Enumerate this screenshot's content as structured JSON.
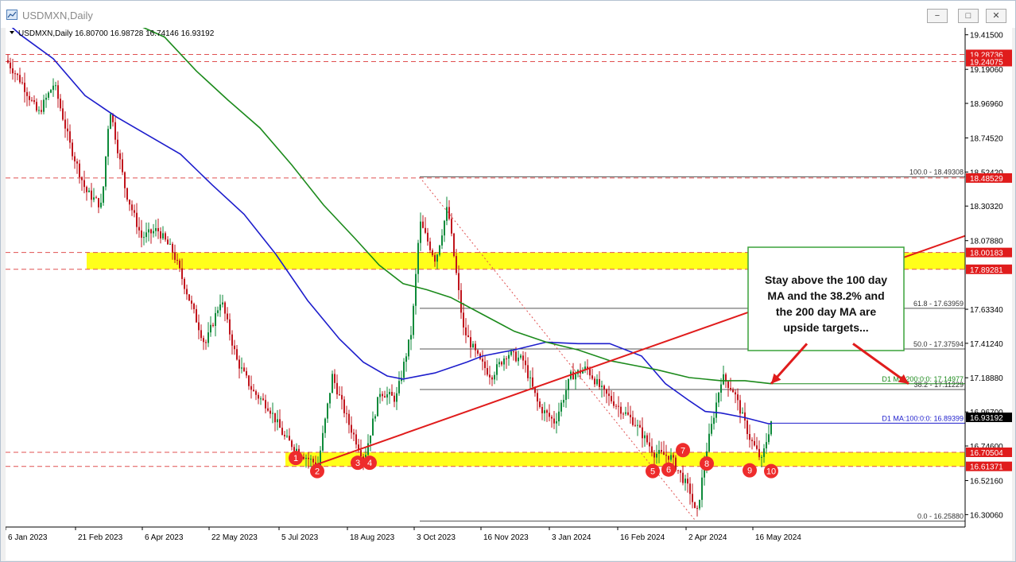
{
  "window": {
    "title": "USDMXN,Daily",
    "minimize_label": "−",
    "maximize_label": "□",
    "close_label": "✕"
  },
  "info_line": {
    "symbol": "USDMXN,Daily",
    "open": "16.80700",
    "high": "16.98728",
    "low": "16.74146",
    "close": "16.93192"
  },
  "colors": {
    "candle_up": "#0d8a3a",
    "candle_down": "#c0141c",
    "ma100": "#1d1dcc",
    "ma200": "#1b8a1b",
    "trendline": "#e01c1c",
    "support_zone": "#ffff1a",
    "marker": "#ee2c2c",
    "current_price_bg": "#000000",
    "level_bg": "#e01c1c"
  },
  "chart_data": {
    "type": "candlestick",
    "symbol": "USDMXN",
    "timeframe": "Daily",
    "x_ticks": [
      "6 Jan 2023",
      "21 Feb 2023",
      "6 Apr 2023",
      "22 May 2023",
      "5 Jul 2023",
      "18 Aug 2023",
      "3 Oct 2023",
      "16 Nov 2023",
      "3 Jan 2024",
      "16 Feb 2024",
      "2 Apr 2024",
      "16 May 2024"
    ],
    "y_ticks": [
      "19.41500",
      "19.19060",
      "18.96960",
      "18.74520",
      "18.52420",
      "18.30320",
      "18.07880",
      "17.63340",
      "17.41240",
      "17.18880",
      "16.96700",
      "16.74600",
      "16.52160",
      "16.30060"
    ],
    "ylim": [
      16.22,
      19.46
    ],
    "price_labels": [
      {
        "value": 19.28736,
        "text": "19.28736"
      },
      {
        "value": 19.24075,
        "text": "19.24075"
      },
      {
        "value": 18.48529,
        "text": "18.48529"
      },
      {
        "value": 18.00183,
        "text": "18.00183"
      },
      {
        "value": 17.89281,
        "text": "17.89281"
      },
      {
        "value": 16.70504,
        "text": "16.70504"
      },
      {
        "value": 16.61371,
        "text": "16.61371"
      }
    ],
    "current_price": {
      "value": 16.93192,
      "text": "16.93192"
    },
    "support_zones": [
      {
        "from": 17.89281,
        "to": 18.00183
      },
      {
        "from": 16.61371,
        "to": 16.70504
      }
    ],
    "fibonacci": [
      {
        "level": "100.0",
        "value": 18.49308,
        "label": "100.0 - 18.49308"
      },
      {
        "level": "61.8",
        "value": 17.63959,
        "label": "61.8 - 17.63959"
      },
      {
        "level": "50.0",
        "value": 17.37594,
        "label": "50.0 - 17.37594"
      },
      {
        "level": "38.2",
        "value": 17.11229,
        "label": "38.2 - 17.11229"
      },
      {
        "level": "0.0",
        "value": 16.2588,
        "label": "0.0 - 16.25880"
      }
    ],
    "ma_labels": [
      {
        "name": "D1 MA:200:0:0",
        "value": 17.14977,
        "label": "D1 MA:200:0:0: 17.14977"
      },
      {
        "name": "D1 MA:100:0:0",
        "value": 16.89399,
        "label": "D1 MA:100:0:0: 16.89399"
      }
    ],
    "ma100_path": [
      [
        0,
        19.5
      ],
      [
        20,
        19.41
      ],
      [
        60,
        19.26
      ],
      [
        100,
        19.02
      ],
      [
        140,
        18.88
      ],
      [
        180,
        18.76
      ],
      [
        220,
        18.64
      ],
      [
        260,
        18.44
      ],
      [
        300,
        18.25
      ],
      [
        340,
        17.99
      ],
      [
        380,
        17.69
      ],
      [
        420,
        17.44
      ],
      [
        450,
        17.29
      ],
      [
        480,
        17.2
      ],
      [
        500,
        17.18
      ],
      [
        540,
        17.22
      ],
      [
        580,
        17.29
      ],
      [
        600,
        17.33
      ],
      [
        640,
        17.37
      ],
      [
        680,
        17.42
      ],
      [
        720,
        17.41
      ],
      [
        760,
        17.41
      ],
      [
        800,
        17.33
      ],
      [
        830,
        17.15
      ],
      [
        860,
        17.04
      ],
      [
        880,
        16.97
      ],
      [
        900,
        16.96
      ],
      [
        930,
        16.93
      ],
      [
        960,
        16.89
      ],
      [
        963,
        16.89
      ]
    ],
    "ma200_path": [
      [
        170,
        19.47
      ],
      [
        200,
        19.4
      ],
      [
        240,
        19.18
      ],
      [
        280,
        18.99
      ],
      [
        320,
        18.81
      ],
      [
        360,
        18.57
      ],
      [
        400,
        18.31
      ],
      [
        440,
        18.09
      ],
      [
        470,
        17.92
      ],
      [
        500,
        17.8
      ],
      [
        530,
        17.76
      ],
      [
        560,
        17.71
      ],
      [
        600,
        17.6
      ],
      [
        640,
        17.49
      ],
      [
        680,
        17.42
      ],
      [
        720,
        17.37
      ],
      [
        760,
        17.3
      ],
      [
        790,
        17.27
      ],
      [
        820,
        17.24
      ],
      [
        860,
        17.19
      ],
      [
        900,
        17.17
      ],
      [
        930,
        17.17
      ],
      [
        963,
        17.15
      ]
    ],
    "trendline": {
      "from": [
        388,
        16.62
      ],
      "to": [
        1207,
        18.11
      ]
    },
    "fib_diagonal": {
      "from": [
        521,
        18.49
      ],
      "to": [
        868,
        16.26
      ]
    },
    "fib_start_x": 521,
    "markers": [
      {
        "label": "1",
        "x": 365,
        "value": 16.668
      },
      {
        "label": "2",
        "x": 392,
        "value": 16.583
      },
      {
        "label": "3",
        "x": 443,
        "value": 16.637
      },
      {
        "label": "4",
        "x": 458,
        "value": 16.637
      },
      {
        "label": "5",
        "x": 814,
        "value": 16.583
      },
      {
        "label": "6",
        "x": 834,
        "value": 16.593
      },
      {
        "label": "7",
        "x": 852,
        "value": 16.719
      },
      {
        "label": "8",
        "x": 882,
        "value": 16.632
      },
      {
        "label": "9",
        "x": 936,
        "value": 16.588
      },
      {
        "label": "10",
        "x": 963,
        "value": 16.583
      }
    ],
    "annotation": {
      "text": "Stay above the 100 day MA and the 38.2% and the 200 day MA are upside targets..."
    },
    "arrows": [
      {
        "from": [
          1008,
          17.41
        ],
        "to": [
          963,
          17.15
        ]
      },
      {
        "from": [
          1066,
          17.41
        ],
        "to": [
          1136,
          17.15
        ]
      }
    ]
  }
}
